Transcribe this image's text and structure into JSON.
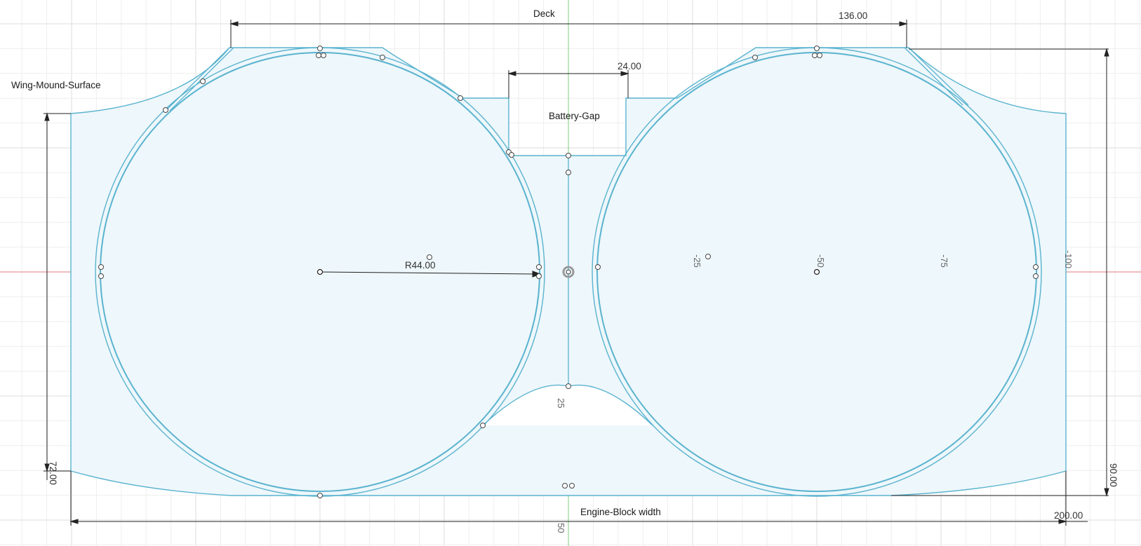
{
  "sketch": {
    "labels": {
      "deck": "Deck",
      "wing_mound_surface": "Wing-Mound-Surface",
      "battery_gap": "Battery-Gap",
      "engine_block_width": "Engine-Block width"
    },
    "dimensions": {
      "deck_offset": "136.00",
      "battery_gap_width": "24.00",
      "radius": "R44.00",
      "left_height": "72.00",
      "right_height": "90.00",
      "overall_width": "200.00"
    },
    "axis_ticks": {
      "x_neg25": "-25",
      "x_neg50": "-50",
      "x_neg75": "-75",
      "x_neg100": "-100",
      "y_25": "25",
      "y_50": "50"
    },
    "colors": {
      "profile_fill": "#eef7fb",
      "profile_stroke": "#5ab3cf",
      "grid_minor": "#eeeeee",
      "grid_major": "#dcdcdc",
      "x_axis": "#e07a7a",
      "y_axis": "#7ccf7c",
      "dimension": "#222222"
    }
  }
}
